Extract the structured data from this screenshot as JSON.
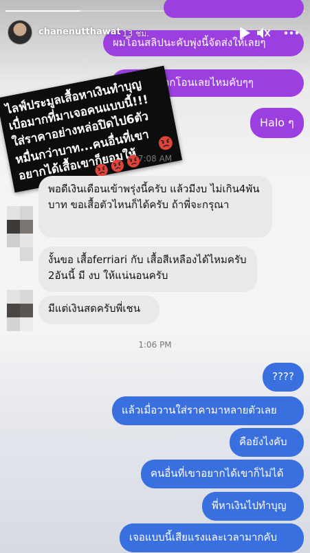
{
  "story": {
    "username": "chanenutthawat",
    "time_ago": "13 ชม.",
    "progress": 0.25
  },
  "sticker": {
    "line1": "ไลฟ์ประมูลเสื้อหาเงินทำบุญ",
    "line2": "เบื่อมากที่มาเจอคนแบบนี้!!!",
    "line3": "ใส่ราคาอย่างหล่อปิดไป6ตัว",
    "line4": "หมื่นกว่าบาท...คนอื่นที่เขา",
    "line5": "อยากได้เสื้อเขาก็ยอมให้"
  },
  "messages": {
    "purple_top_1": "ผมโอนสลิปนะคับพุ่งนี้จัดส่งให้เลยๆ",
    "purple_top_2": "ถ้าไม่สะดวกโอนเลยไหมคับๆๆ",
    "purple_halo": "Halo ๆ",
    "time_1": "7:08 AM",
    "gray_1": "พอดีเงินเดือนเข้าพรุ่งนี้ครับ แล้วมีงบ ไม่เกิน4พันบาท ขอเสื้อตัวไหนก็ได้ครับ ถ้าพี่จะกรุณา",
    "gray_2": "งั้นขอ เสื้อferriari กับ เสื้อสีเหลืองได้ไหมครับ 2อันนี้ มี งบ ให้แน่นอนครับ",
    "gray_3": "มีแต่เงินสดครับพี่เชน",
    "time_2": "1:06 PM",
    "blue_1": "????",
    "blue_2": "แล้วเมื่อวานใส่ราคามาหลายตัวเลย",
    "blue_3": "คือยังไงคับ",
    "blue_4": "คนอื่นที่เขาอยากได้เขาก็ไม่ได้",
    "blue_5": "พี่หาเงินไปทำบุญ",
    "blue_6": "เจอแบบนี้เสียแรงและเวลามากคับ"
  },
  "colors": {
    "purple": "#9b3fe0",
    "blue": "#3a6fdf",
    "gray_bubble": "#e9e9ec"
  },
  "icons": {
    "play": "play-icon",
    "mute": "speaker-muted-icon",
    "more": "more-icon",
    "emoji": "angry-face-emoji-icon"
  }
}
